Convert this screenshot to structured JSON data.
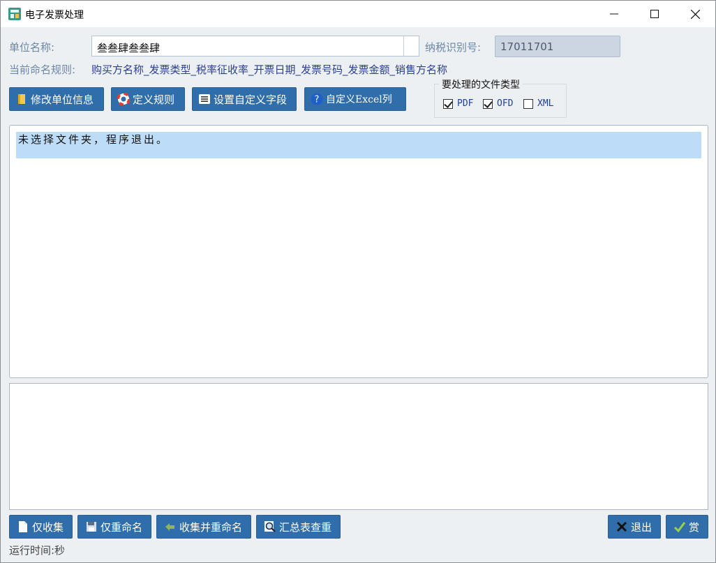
{
  "window": {
    "title": "电子发票处理"
  },
  "form": {
    "unit_name_label": "单位名称:",
    "unit_name_value": "叁叁肆叁叁肆",
    "tax_id_label": "纳税识别号:",
    "tax_id_value": "17011701",
    "rule_label": "当前命名规则:",
    "rule_value": "购买方名称_发票类型_税率征收率_开票日期_发票号码_发票金额_销售方名称"
  },
  "toolbar": {
    "edit_unit_label": "修改单位信息",
    "define_rule_label": "定义规则",
    "custom_fields_label": "设置自定义字段",
    "custom_excel_label": "自定义Excel列"
  },
  "file_types": {
    "title": "要处理的文件类型",
    "options": [
      {
        "label": "PDF",
        "checked": true
      },
      {
        "label": "OFD",
        "checked": true
      },
      {
        "label": "XML",
        "checked": false
      }
    ]
  },
  "log": {
    "selected_line": "未选择文件夹，程序退出。"
  },
  "bottom": {
    "collect_label": "仅收集",
    "rename_label": "仅重命名",
    "collect_rename_label": "收集并重命名",
    "summary_label": "汇总表查重",
    "exit_label": "退出",
    "reward_label": "赏"
  },
  "status": {
    "runtime_text": "运行时间:秒"
  },
  "colors": {
    "button_blue": "#2f6eaa",
    "label_blue": "#6b86a6",
    "selection": "#bcdcf7"
  }
}
